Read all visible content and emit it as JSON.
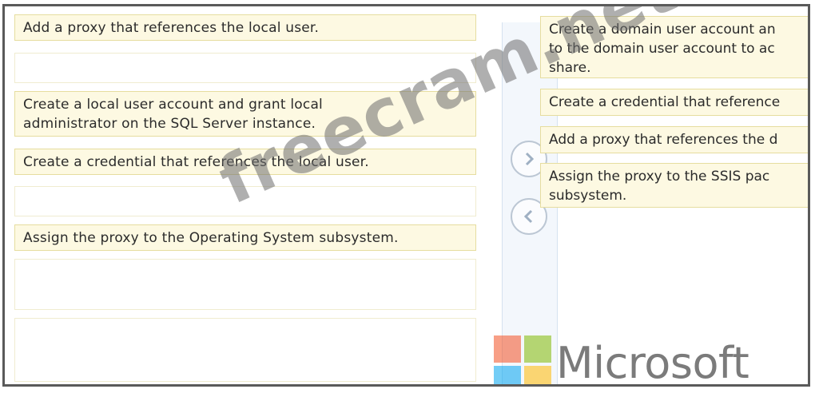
{
  "left_items": [
    {
      "text": "Add a proxy that references the local user."
    },
    {
      "text": ""
    },
    {
      "text": "Create a local user account and grant local administrator on the SQL Server instance."
    },
    {
      "text": "Create a credential that references the local user."
    },
    {
      "text": ""
    },
    {
      "text": "Assign the proxy to the Operating System subsystem."
    },
    {
      "text": ""
    },
    {
      "text": ""
    }
  ],
  "right_items": [
    {
      "line1": "Create a domain user account an",
      "line2": "to the domain user account to ac",
      "line3": "share."
    },
    {
      "line1": "Create a credential that reference"
    },
    {
      "line1": "Add a proxy that references the d"
    },
    {
      "line1": "Assign the proxy to the SSIS pac",
      "line2": "subsystem."
    }
  ],
  "watermark": "freecram.net",
  "brand": {
    "name": "Microsoft",
    "colors": [
      "#f25022",
      "#7fba00",
      "#00a4ef",
      "#ffb900"
    ]
  },
  "icons": {
    "move_right": "chevron-right-icon",
    "move_left": "chevron-left-icon"
  }
}
